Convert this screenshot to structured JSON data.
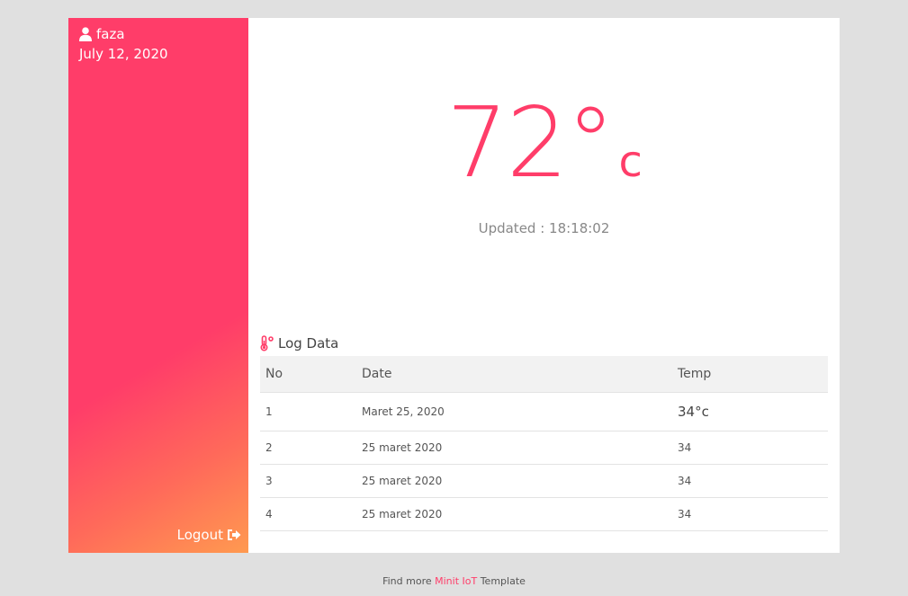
{
  "sidebar": {
    "username": "faza",
    "date": "July 12, 2020",
    "logout_label": "Logout",
    "user_icon": "user-icon",
    "logout_icon": "sign-out-icon"
  },
  "reading": {
    "value": "72°",
    "unit": "c",
    "updated": "Updated : 18:18:02"
  },
  "log": {
    "title": "Log Data",
    "icon": "thermometer-icon",
    "headers": [
      "No",
      "Date",
      "Temp"
    ],
    "rows": [
      {
        "no": "1",
        "date": "Maret 25, 2020",
        "temp": "34°c"
      },
      {
        "no": "2",
        "date": "25 maret 2020",
        "temp": "34"
      },
      {
        "no": "3",
        "date": "25 maret 2020",
        "temp": "34"
      },
      {
        "no": "4",
        "date": "25 maret 2020",
        "temp": "34"
      }
    ]
  },
  "footer": {
    "prefix": "Find more",
    "link": "Minit IoT",
    "suffix": "Template"
  },
  "colors": {
    "accent": "#ff3d69",
    "gradient_end": "#ff9a50",
    "background": "#e0e0e0"
  }
}
